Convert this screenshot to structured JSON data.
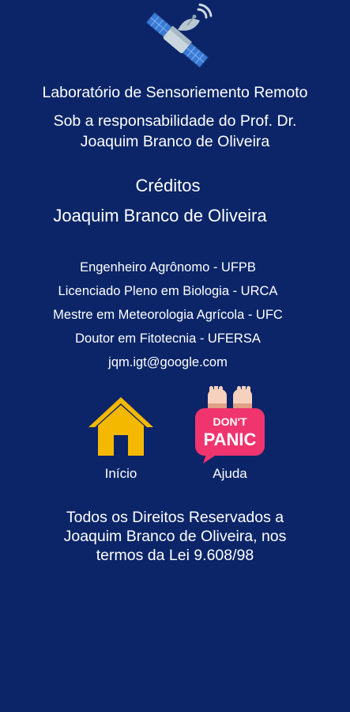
{
  "header": {
    "logo_icon": "satellite-icon",
    "lab_name": "Laboratório de Sensoriemento Remoto",
    "responsible_line1": "Sob a responsabilidade do Prof. Dr.",
    "responsible_line2": "Joaquim Branco de Oliveira"
  },
  "credits": {
    "title": "Créditos",
    "name": "Joaquim Branco de Oliveira",
    "qualifications": [
      "Engenheiro Agrônomo - UFPB",
      "Licenciado Pleno em Biologia - URCA",
      "Mestre em Meteorologia Agrícola - UFC",
      "Doutor em Fitotecnia - UFERSA",
      "jqm.igt@google.com"
    ]
  },
  "nav": {
    "home": {
      "label": "Início",
      "icon": "home-icon",
      "color": "#f5b800"
    },
    "help": {
      "label": "Ajuda",
      "icon": "dont-panic-icon",
      "badge_line1": "DON'T",
      "badge_line2": "PANIC",
      "color": "#f0346e"
    }
  },
  "footer": {
    "line1": "Todos os Direitos Reservados a",
    "line2": "Joaquim Branco de Oliveira, nos",
    "line3": "termos da Lei 9.608/98"
  },
  "colors": {
    "background": "#0b2568",
    "text": "#ffffff"
  }
}
